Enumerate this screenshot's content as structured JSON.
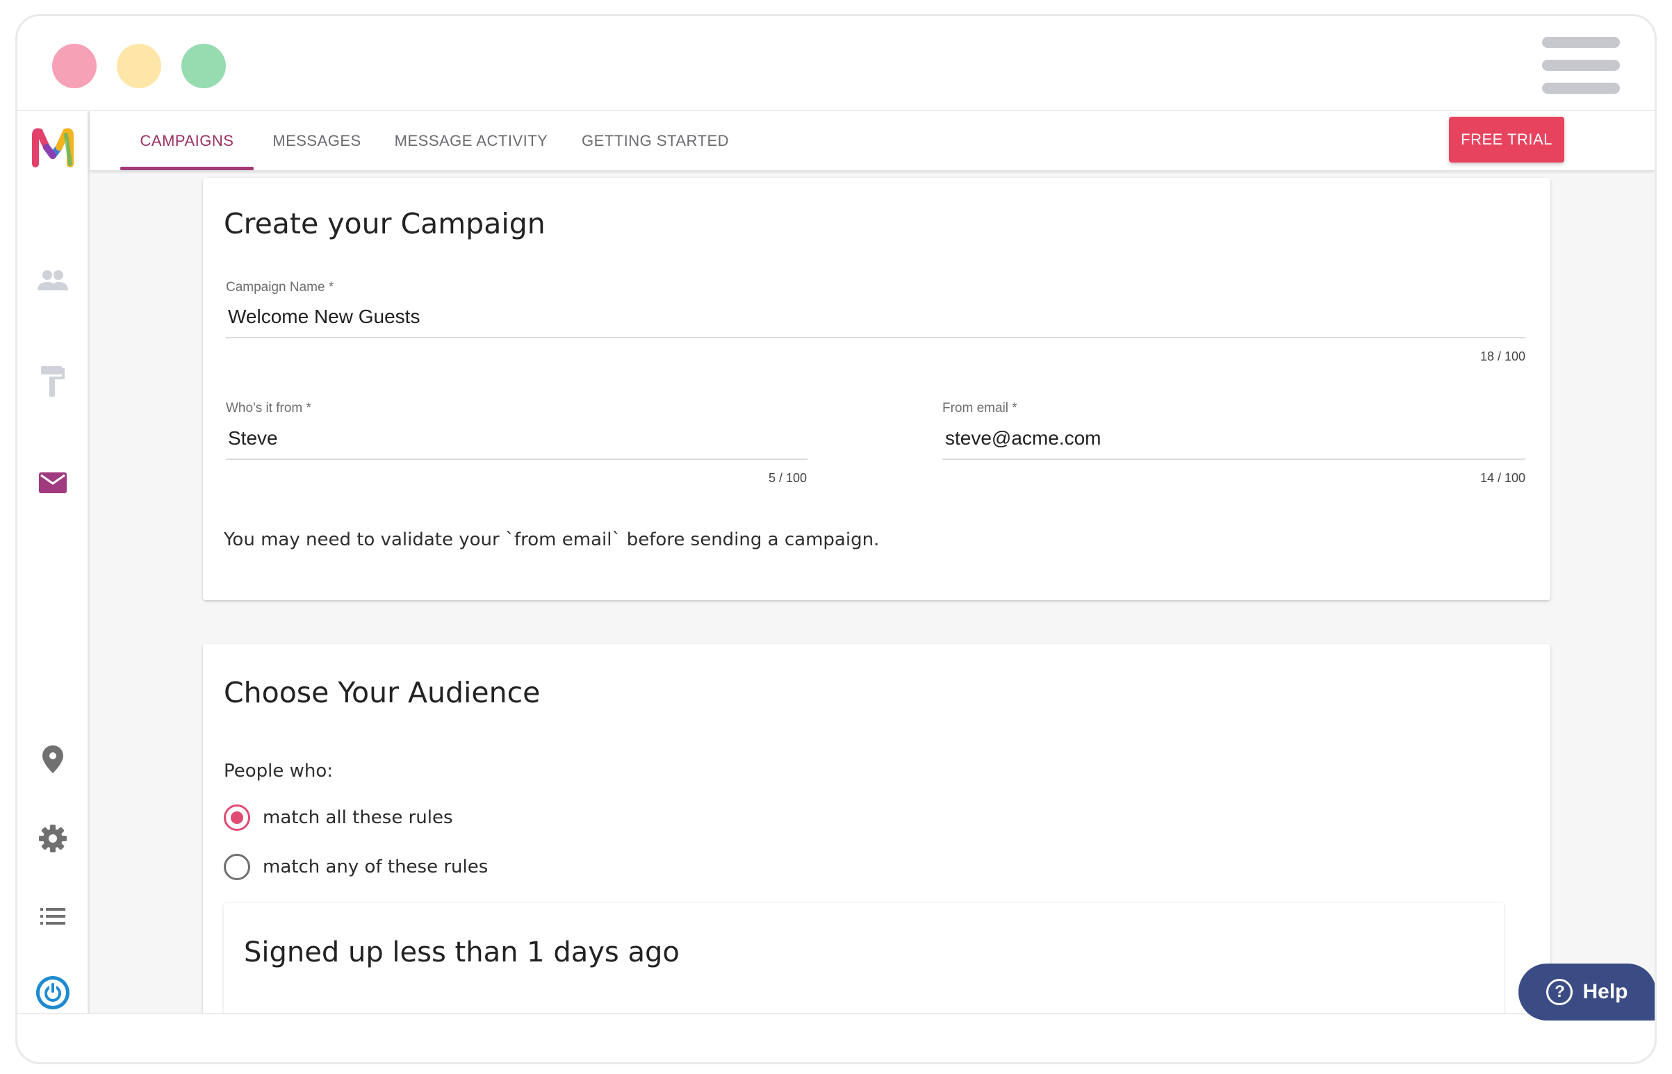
{
  "window": {
    "controls": [
      "close",
      "minimize",
      "maximize"
    ],
    "menu_icon": "hamburger-menu-icon"
  },
  "sidebar": {
    "items": [
      {
        "name": "logo",
        "icon": "brand-logo-m-icon"
      },
      {
        "name": "contacts",
        "icon": "people-icon"
      },
      {
        "name": "design",
        "icon": "paint-roller-icon"
      },
      {
        "name": "campaigns",
        "icon": "mail-icon",
        "active": true
      },
      {
        "name": "locations",
        "icon": "location-pin-icon"
      },
      {
        "name": "settings",
        "icon": "gear-icon"
      },
      {
        "name": "lists",
        "icon": "list-icon"
      },
      {
        "name": "logout",
        "icon": "power-icon"
      }
    ]
  },
  "nav": {
    "tabs": [
      {
        "label": "CAMPAIGNS",
        "active": true
      },
      {
        "label": "MESSAGES"
      },
      {
        "label": "MESSAGE ACTIVITY"
      },
      {
        "label": "GETTING STARTED"
      }
    ],
    "trial_button": "FREE TRIAL"
  },
  "campaign": {
    "title": "Create your Campaign",
    "name_label": "Campaign Name *",
    "name_value": "Welcome New Guests",
    "name_counter": "18 / 100",
    "from_label": "Who's it from *",
    "from_value": "Steve",
    "from_counter": "5 / 100",
    "email_label": "From email *",
    "email_value": "steve@acme.com",
    "email_counter": "14 / 100",
    "hint": "You may need to validate your `from email` before sending a campaign."
  },
  "audience": {
    "title": "Choose Your Audience",
    "people_label": "People who:",
    "options": [
      {
        "label": "match all these rules",
        "selected": true
      },
      {
        "label": "match any of these rules",
        "selected": false
      }
    ],
    "rule": "Signed up less than 1 days ago"
  },
  "help": {
    "label": "Help",
    "icon": "?"
  },
  "colors": {
    "accent": "#a23b76",
    "trial": "#e8435e",
    "radio": "#e14a72",
    "help": "#3b4c85"
  }
}
